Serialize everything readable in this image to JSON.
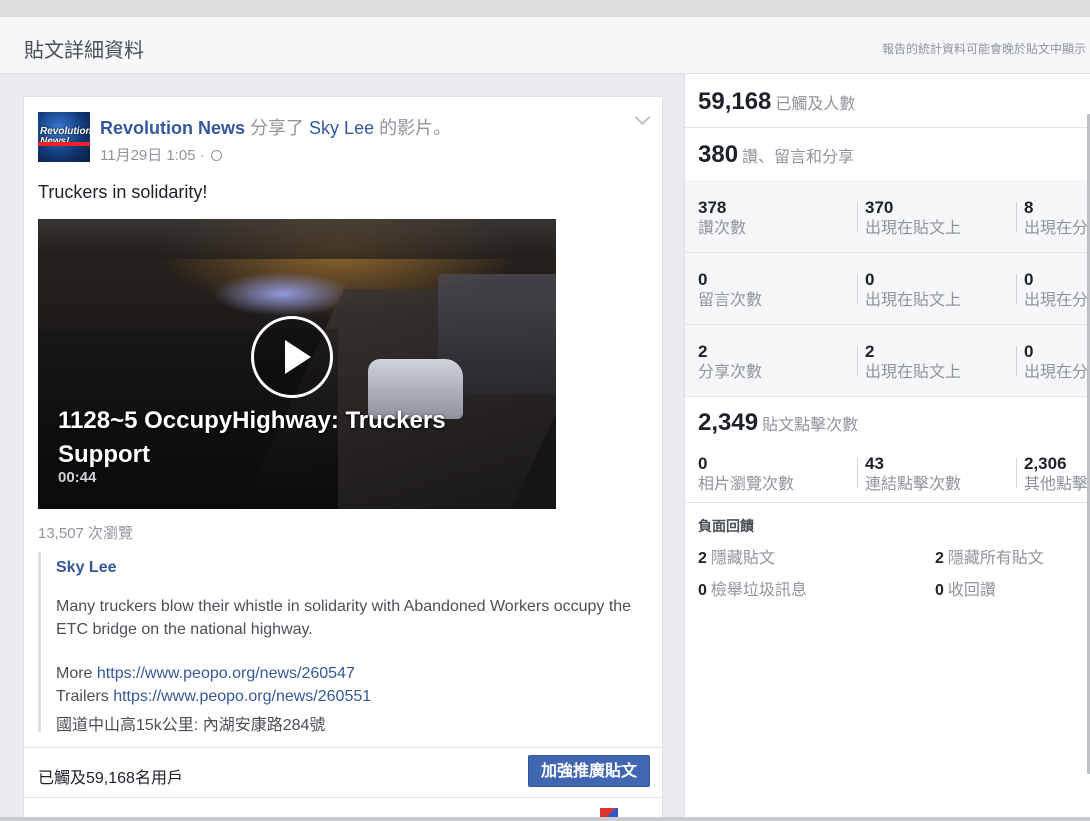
{
  "header": {
    "title": "貼文詳細資料",
    "note": "報告的統計資料可能會晚於貼文中顯示"
  },
  "post": {
    "page_name": "Revolution News",
    "shared_text": " 分享了 ",
    "owner": "Sky Lee",
    "suffix": " 的影片。",
    "timestamp": "11月29日 1:05 ·",
    "avatar_text": "Revolution News!",
    "message": "Truckers in solidarity!",
    "video": {
      "title": "1128~5 OccupyHighway: Truckers Support",
      "duration": "00:44"
    },
    "views": "13,507 次瀏覽",
    "quote": {
      "author": "Sky Lee",
      "description": "Many truckers blow their whistle in solidarity with Abandoned Workers occupy the ETC bridge on the national highway.",
      "more_label": "More ",
      "more_link": "https://www.peopo.org/news/260547",
      "trailers_label": "Trailers ",
      "trailers_link": "https://www.peopo.org/news/260551",
      "address": "國道中山高15k公里: 內湖安康路284號"
    },
    "reach_text": "已觸及59,168名用戶",
    "boost_label": "加強推廣貼文"
  },
  "stats": {
    "reach": {
      "value": "59,168",
      "label": "已觸及人數"
    },
    "engagement": {
      "value": "380",
      "label": "讚、留言和分享"
    },
    "rows": [
      [
        {
          "num": "378",
          "label": "讚次數"
        },
        {
          "num": "370",
          "label": "出現在貼文上"
        },
        {
          "num": "8",
          "label": "出現在分享內容上"
        }
      ],
      [
        {
          "num": "0",
          "label": "留言次數"
        },
        {
          "num": "0",
          "label": "出現在貼文上"
        },
        {
          "num": "0",
          "label": "出現在分享內容上"
        }
      ],
      [
        {
          "num": "2",
          "label": "分享次數"
        },
        {
          "num": "2",
          "label": "出現在貼文上"
        },
        {
          "num": "0",
          "label": "出現在分享內容上"
        }
      ]
    ],
    "clicks": {
      "value": "2,349",
      "label": "貼文點擊次數"
    },
    "click_breakdown": [
      {
        "num": "0",
        "label": "相片瀏覽次數"
      },
      {
        "num": "43",
        "label": "連結點擊次數"
      },
      {
        "num": "2,306",
        "label": "其他點擊"
      }
    ],
    "negative": {
      "title": "負面回饋",
      "items": [
        {
          "num": "2",
          "label": "隱藏貼文"
        },
        {
          "num": "2",
          "label": "隱藏所有貼文"
        },
        {
          "num": "0",
          "label": "檢舉垃圾訊息"
        },
        {
          "num": "0",
          "label": "收回讚"
        }
      ]
    }
  }
}
